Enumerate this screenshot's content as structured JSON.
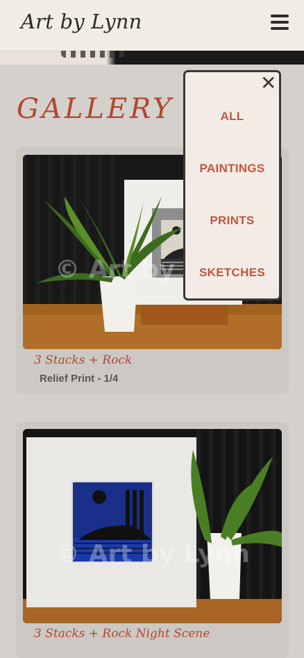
{
  "header": {
    "logo": "Art by Lynn",
    "menu_icon": "hamburger-menu-icon"
  },
  "page": {
    "title": "GALLERY - I"
  },
  "menu": {
    "close_glyph": "✕",
    "items": [
      {
        "label": "ALL"
      },
      {
        "label": "PAINTINGS"
      },
      {
        "label": "PRINTS"
      },
      {
        "label": "SKETCHES"
      }
    ]
  },
  "gallery": [
    {
      "watermark": "© Art by Lynn",
      "title": "3 Stacks + Rock",
      "subtitle": "Relief Print - 1/4"
    },
    {
      "watermark": "© Art by Lynn",
      "title": "3 Stacks + Rock Night Scene"
    }
  ],
  "colors": {
    "accent": "#b2472f",
    "header_bg": "#f2ece6",
    "page_bg": "#d4d0cb",
    "card_bg": "#ccc8c3"
  }
}
